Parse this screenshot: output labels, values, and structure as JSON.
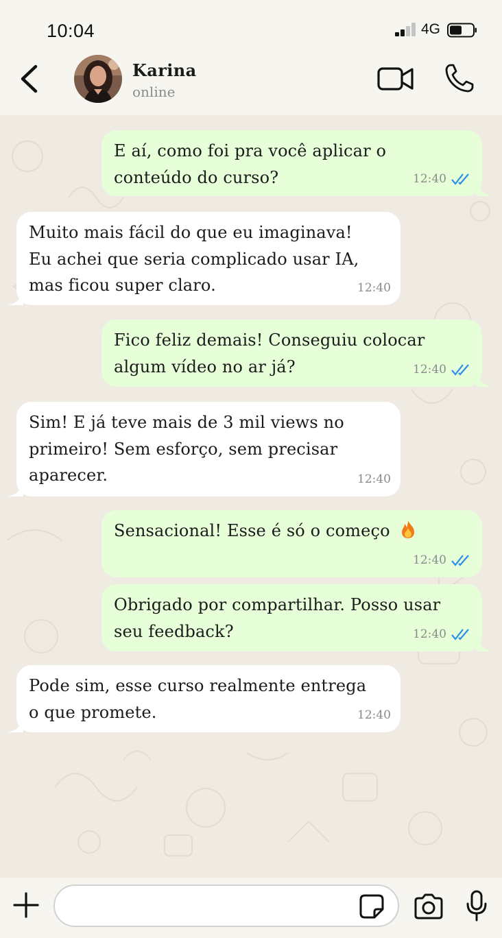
{
  "status_bar": {
    "time": "10:04",
    "network": "4G"
  },
  "header": {
    "contact_name": "Karina",
    "contact_status": "online"
  },
  "messages": [
    {
      "direction": "out",
      "lines": [
        "E aí, como foi pra você aplicar o",
        "conteúdo do curso?"
      ],
      "time": "12:40",
      "read": true
    },
    {
      "direction": "in",
      "lines": [
        "Muito mais fácil do que eu imaginava!",
        "Eu achei que seria complicado usar IA,",
        "mas ficou super claro."
      ],
      "time": "12:40"
    },
    {
      "direction": "out",
      "lines": [
        "Fico feliz demais! Conseguiu colocar",
        "algum vídeo no ar já?"
      ],
      "time": "12:40",
      "read": true
    },
    {
      "direction": "in",
      "lines": [
        "Sim! E já teve mais de 3 mil views no",
        "primeiro! Sem esforço, sem precisar",
        "aparecer."
      ],
      "time": "12:40"
    },
    {
      "direction": "out",
      "lines": [
        "Sensacional! Esse é só o começo"
      ],
      "emoji": "fire-emoji",
      "time": "12:40",
      "read": true
    },
    {
      "direction": "out",
      "lines": [
        "Obrigado por compartilhar. Posso usar",
        "seu feedback?"
      ],
      "time": "12:40",
      "read": true
    },
    {
      "direction": "in",
      "lines": [
        "Pode sim, esse curso realmente entrega",
        "o que promete."
      ],
      "time": "12:40"
    }
  ],
  "input": {
    "value": "",
    "placeholder": ""
  },
  "icons": {
    "back": "chevron-left-icon",
    "video": "video-camera-icon",
    "call": "phone-icon",
    "attach": "plus-icon",
    "sticker": "sticker-icon",
    "camera": "camera-icon",
    "mic": "microphone-icon"
  },
  "colors": {
    "outgoing_bubble": "#e6ffd9",
    "incoming_bubble": "#ffffff",
    "read_ticks": "#2b8fe8",
    "chat_background": "#efeae2"
  }
}
